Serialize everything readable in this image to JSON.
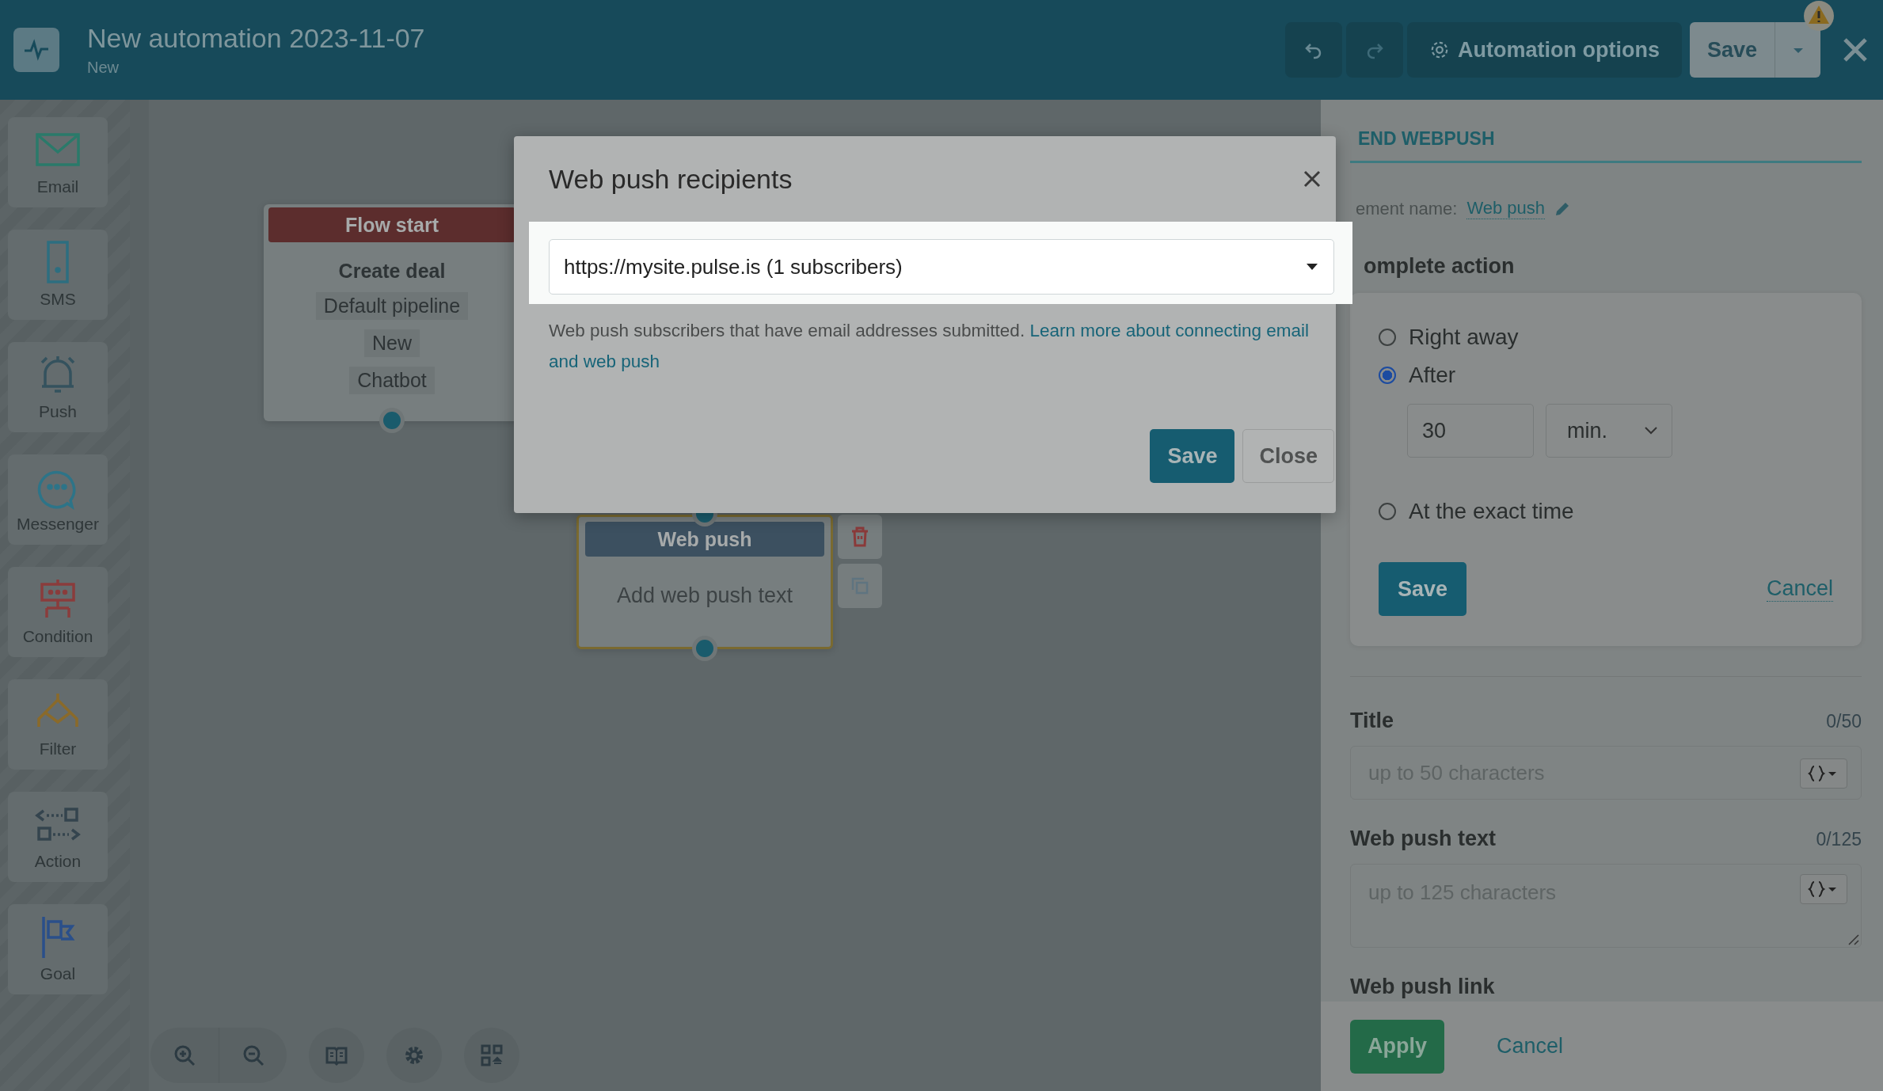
{
  "header": {
    "title": "New automation 2023-11-07",
    "subtitle": "New",
    "options": "Automation options",
    "save": "Save"
  },
  "sidebar": {
    "items": [
      {
        "label": "Email",
        "kind": "email"
      },
      {
        "label": "SMS",
        "kind": "sms"
      },
      {
        "label": "Push",
        "kind": "push"
      },
      {
        "label": "Messenger",
        "kind": "messenger"
      },
      {
        "label": "Condition",
        "kind": "condition"
      },
      {
        "label": "Filter",
        "kind": "filter"
      },
      {
        "label": "Action",
        "kind": "action"
      },
      {
        "label": "Goal",
        "kind": "goal"
      }
    ]
  },
  "canvas": {
    "nodes": [
      {
        "kind": "start",
        "header": "Flow start",
        "title": "Create deal",
        "tags": [
          "Default pipeline",
          "New",
          "Chatbot"
        ]
      },
      {
        "kind": "webpush",
        "header": "Web push",
        "body": "Add web push text"
      }
    ]
  },
  "panel": {
    "heading": "END WEBPUSH",
    "name_label": "ement name:",
    "name_value": "Web push",
    "section": "omplete action",
    "options": [
      {
        "label": "Right away",
        "selected": false
      },
      {
        "label": "After",
        "selected": true,
        "value": "30",
        "unit": "min."
      },
      {
        "label": "At the exact time",
        "selected": false
      }
    ],
    "save": "Save",
    "cancel": "Cancel",
    "fields": [
      {
        "kind": "input",
        "label": "Title",
        "counter": "0/50",
        "placeholder": "up to 50 characters"
      },
      {
        "kind": "textarea",
        "label": "Web push text",
        "counter": "0/125",
        "placeholder": "up to 125 characters"
      },
      {
        "kind": "cut",
        "label": "Web push link"
      }
    ],
    "apply": "Apply",
    "footer_cancel": "Cancel"
  },
  "modal": {
    "title": "Web push recipients",
    "select_value": "https://mysite.pulse.is (1 subscribers)",
    "help": "Web push subscribers that have email addresses submitted.",
    "link": "Learn more about connecting email and web push",
    "save": "Save",
    "close": "Close"
  }
}
